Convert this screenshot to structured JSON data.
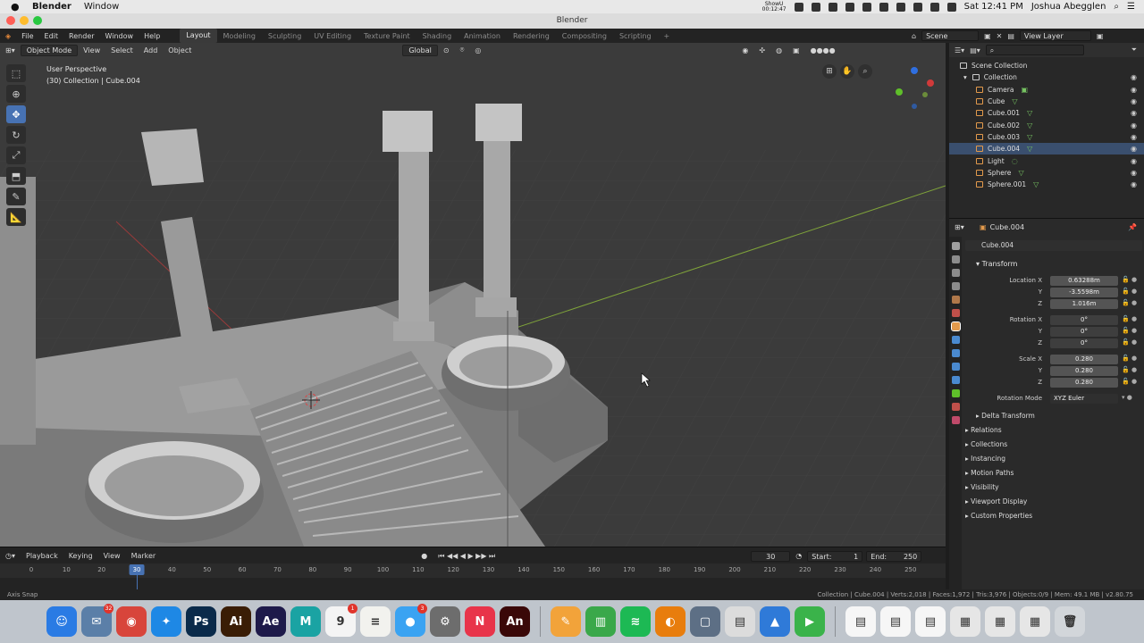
{
  "mac_menubar": {
    "app_name": "Blender",
    "menu_window": "Window",
    "show_label": "ShowU",
    "show_time": "00:12:47",
    "clock": "Sat 12:41 PM",
    "user": "Joshua Abegglen"
  },
  "window": {
    "title": "Blender"
  },
  "topbar": {
    "menus": [
      "File",
      "Edit",
      "Render",
      "Window",
      "Help"
    ],
    "workspaces": [
      "Layout",
      "Modeling",
      "Sculpting",
      "UV Editing",
      "Texture Paint",
      "Shading",
      "Animation",
      "Rendering",
      "Compositing",
      "Scripting"
    ],
    "active_workspace": "Layout",
    "add_workspace": "+",
    "scene": "Scene",
    "view_layer": "View Layer"
  },
  "viewport": {
    "mode": "Object Mode",
    "menus": [
      "View",
      "Select",
      "Add",
      "Object"
    ],
    "transform_orientation": "Global",
    "perspective": "User Perspective",
    "collection_info": "(30) Collection | Cube.004"
  },
  "outliner": {
    "root": "Scene Collection",
    "collection": "Collection",
    "items": [
      {
        "name": "Camera",
        "type": "camera"
      },
      {
        "name": "Cube",
        "type": "mesh"
      },
      {
        "name": "Cube.001",
        "type": "mesh"
      },
      {
        "name": "Cube.002",
        "type": "mesh"
      },
      {
        "name": "Cube.003",
        "type": "mesh"
      },
      {
        "name": "Cube.004",
        "type": "mesh",
        "selected": true
      },
      {
        "name": "Light",
        "type": "light"
      },
      {
        "name": "Sphere",
        "type": "mesh"
      },
      {
        "name": "Sphere.001",
        "type": "mesh"
      }
    ]
  },
  "properties": {
    "header_object": "Cube.004",
    "object_name": "Cube.004",
    "transform_title": "Transform",
    "location_label": "Location X",
    "location": [
      "0.63288m",
      "-3.5598m",
      "1.016m"
    ],
    "rotation_label": "Rotation X",
    "rotation": [
      "0°",
      "0°",
      "0°"
    ],
    "scale_label": "Scale X",
    "scale": [
      "0.280",
      "0.280",
      "0.280"
    ],
    "axis_y": "Y",
    "axis_z": "Z",
    "rotation_mode_label": "Rotation Mode",
    "rotation_mode": "XYZ Euler",
    "delta_transform": "Delta Transform",
    "panels": [
      "Relations",
      "Collections",
      "Instancing",
      "Motion Paths",
      "Visibility",
      "Viewport Display",
      "Custom Properties"
    ]
  },
  "timeline": {
    "menus": [
      "Playback",
      "Keying",
      "View",
      "Marker"
    ],
    "current_frame": "30",
    "start_label": "Start:",
    "start": "1",
    "end_label": "End:",
    "end": "250",
    "ticks": [
      "0",
      "10",
      "20",
      "30",
      "40",
      "50",
      "60",
      "70",
      "80",
      "90",
      "100",
      "110",
      "120",
      "130",
      "140",
      "150",
      "160",
      "170",
      "180",
      "190",
      "200",
      "210",
      "220",
      "230",
      "240",
      "250"
    ]
  },
  "statusbar": {
    "left": "Axis Snap",
    "right": "Collection | Cube.004 | Verts:2,018 | Faces:1,972 | Tris:3,976 | Objects:0/9 | Mem: 49.1 MB | v2.80.75"
  },
  "dock": {
    "apps": [
      {
        "name": "Finder",
        "color": "#2a7be4",
        "glyph": "☺"
      },
      {
        "name": "Preview",
        "color": "#5b7fa8",
        "glyph": "✉",
        "badge": "32"
      },
      {
        "name": "Chrome",
        "color": "#d8453b",
        "glyph": "◉"
      },
      {
        "name": "Safari",
        "color": "#1e88e5",
        "glyph": "✦"
      },
      {
        "name": "Photoshop",
        "color": "#0a2a4a",
        "glyph": "Ps"
      },
      {
        "name": "Illustrator",
        "color": "#3a1d05",
        "glyph": "Ai"
      },
      {
        "name": "After Effects",
        "color": "#1e1a4a",
        "glyph": "Ae"
      },
      {
        "name": "Maya",
        "color": "#1aa3a3",
        "glyph": "M"
      },
      {
        "name": "Calendar",
        "color": "#f4f4f4",
        "glyph": "9",
        "badge": "1"
      },
      {
        "name": "Notes",
        "color": "#f2f2ee",
        "glyph": "≡"
      },
      {
        "name": "Messages",
        "color": "#3aa3f2",
        "glyph": "●",
        "badge": "3"
      },
      {
        "name": "System Preferences",
        "color": "#6d6d6d",
        "glyph": "⚙"
      },
      {
        "name": "News",
        "color": "#e8344a",
        "glyph": "N"
      },
      {
        "name": "Animate",
        "color": "#3a0808",
        "glyph": "An"
      }
    ],
    "apps_right": [
      {
        "name": "Pages",
        "color": "#f2a33a",
        "glyph": "✎"
      },
      {
        "name": "Numbers",
        "color": "#3aa84a",
        "glyph": "▥"
      },
      {
        "name": "Spotify",
        "color": "#1db954",
        "glyph": "≋"
      },
      {
        "name": "Blender",
        "color": "#e87d0d",
        "glyph": "◐"
      },
      {
        "name": "Screenshot",
        "color": "#5d6f85",
        "glyph": "▢"
      },
      {
        "name": "Archive",
        "color": "#dcdcdc",
        "glyph": "▤"
      },
      {
        "name": "Keynote",
        "color": "#2f7ad8",
        "glyph": "▲"
      },
      {
        "name": "Camtasia",
        "color": "#3ab34a",
        "glyph": "▶"
      }
    ],
    "docs": [
      {
        "name": "Document 1",
        "color": "#f6f6f6",
        "glyph": "▤"
      },
      {
        "name": "Document 2",
        "color": "#f6f6f6",
        "glyph": "▤"
      },
      {
        "name": "Document 3",
        "color": "#f6f6f6",
        "glyph": "▤"
      },
      {
        "name": "Folder 1",
        "color": "#e6e6e6",
        "glyph": "▦"
      },
      {
        "name": "Folder 2",
        "color": "#e6e6e6",
        "glyph": "▦"
      },
      {
        "name": "Folder 3",
        "color": "#e6e6e6",
        "glyph": "▦"
      },
      {
        "name": "Trash",
        "color": "#d2d6da",
        "glyph": "🗑"
      }
    ]
  }
}
